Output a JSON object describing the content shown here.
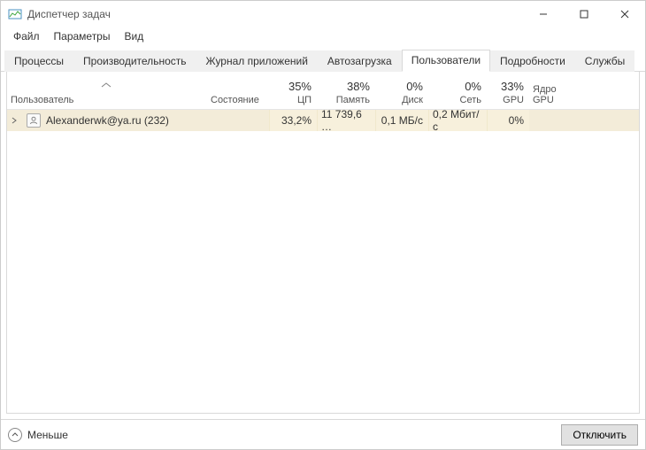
{
  "window": {
    "title": "Диспетчер задач"
  },
  "menu": {
    "file": "Файл",
    "options": "Параметры",
    "view": "Вид"
  },
  "tabs": {
    "processes": "Процессы",
    "performance": "Производительность",
    "app_history": "Журнал приложений",
    "startup": "Автозагрузка",
    "users": "Пользователи",
    "details": "Подробности",
    "services": "Службы"
  },
  "columns": {
    "user": "Пользователь",
    "state": "Состояние",
    "cpu": {
      "pct": "35%",
      "label": "ЦП"
    },
    "mem": {
      "pct": "38%",
      "label": "Память"
    },
    "disk": {
      "pct": "0%",
      "label": "Диск"
    },
    "net": {
      "pct": "0%",
      "label": "Сеть"
    },
    "gpu": {
      "pct": "33%",
      "label": "GPU"
    },
    "gpue": {
      "label": "Ядро GPU"
    }
  },
  "rows": [
    {
      "user": "Alexanderwk@ya.ru (232)",
      "state": "",
      "cpu": "33,2%",
      "mem": "11 739,6 …",
      "disk": "0,1 МБ/с",
      "net": "0,2 Мбит/с",
      "gpu": "0%",
      "gpue": ""
    }
  ],
  "footer": {
    "less": "Меньше",
    "disconnect": "Отключить"
  }
}
